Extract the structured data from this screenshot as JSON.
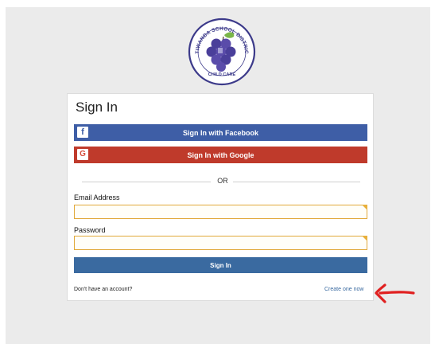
{
  "logo": {
    "arc_text": "ETIWANDA SCHOOL DISTRICT",
    "bottom_text": "CHILD CARE"
  },
  "signin": {
    "title": "Sign In",
    "facebook_label": "Sign In with Facebook",
    "google_label": "Sign In with Google",
    "or_text": "OR",
    "email_label": "Email Address",
    "email_value": "",
    "password_label": "Password",
    "password_value": "",
    "submit_label": "Sign In",
    "no_account_text": "Don't have an account?",
    "create_link_text": "Create one now"
  },
  "colors": {
    "facebook": "#3e5ea6",
    "google": "#bf3a2b",
    "primary": "#3a6aa0",
    "input_border": "#e1a93a",
    "annotation": "#e02020"
  },
  "icons": {
    "facebook": "facebook-icon",
    "google": "google-icon",
    "field_marker": "required-marker-icon",
    "annotation": "red-arrow-icon"
  }
}
